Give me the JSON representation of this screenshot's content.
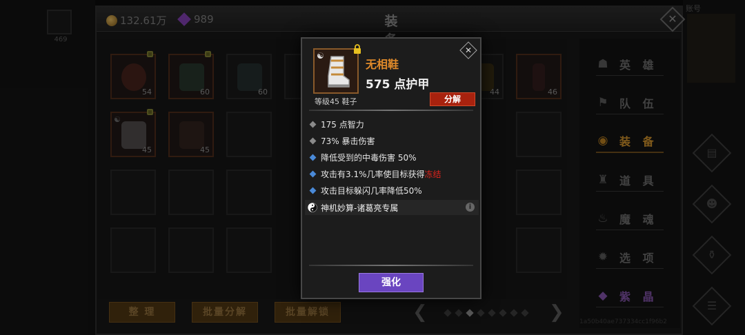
{
  "currency": {
    "gold": "132.61万",
    "gems": "989"
  },
  "window": {
    "title": "装 备"
  },
  "background": {
    "left_slot_number": "469",
    "right_text": "账号"
  },
  "grid": {
    "row1_levels": [
      "54",
      "60",
      "60",
      "44",
      "46"
    ],
    "row2_levels": [
      "45",
      "45"
    ]
  },
  "menu": [
    {
      "label": "英 雄",
      "icon": "heroes-icon"
    },
    {
      "label": "队 伍",
      "icon": "team-flag-icon"
    },
    {
      "label": "装 备",
      "icon": "helmet-icon",
      "active": true
    },
    {
      "label": "道 具",
      "icon": "bag-icon"
    },
    {
      "label": "魔 魂",
      "icon": "flame-icon"
    },
    {
      "label": "选 项",
      "icon": "gear-icon"
    },
    {
      "label": "紫 晶",
      "icon": "purple-crystal-icon"
    }
  ],
  "side_footer": "1a50b40ae737334cc1f96b2",
  "bottom_buttons": {
    "sort": "整 理",
    "batch_decompose": "批量分解",
    "batch_unlock": "批量解锁"
  },
  "pager": {
    "total": 8,
    "current": 3
  },
  "popup": {
    "item_name": "无相鞋",
    "armor": "575 点护甲",
    "meta": "等级45 鞋子",
    "decompose_label": "分解",
    "stats": [
      {
        "text": "175 点智力",
        "type": "base"
      },
      {
        "text": "73% 暴击伤害",
        "type": "base"
      },
      {
        "text": "降低受到的中毒伤害 50%",
        "type": "affix"
      },
      {
        "text_before": "攻击有3.1%几率使目标获得",
        "highlight": "冻结",
        "type": "affix"
      },
      {
        "text": "攻击目标躲闪几率降低50%",
        "type": "affix"
      }
    ],
    "set_bonus": "神机妙算-诸葛亮专属",
    "enhance_label": "强化",
    "colors": {
      "name": "#e08a2a",
      "decompose": "#a8220e",
      "enhance": "#6a45c0",
      "freeze": "#e0241c"
    }
  }
}
